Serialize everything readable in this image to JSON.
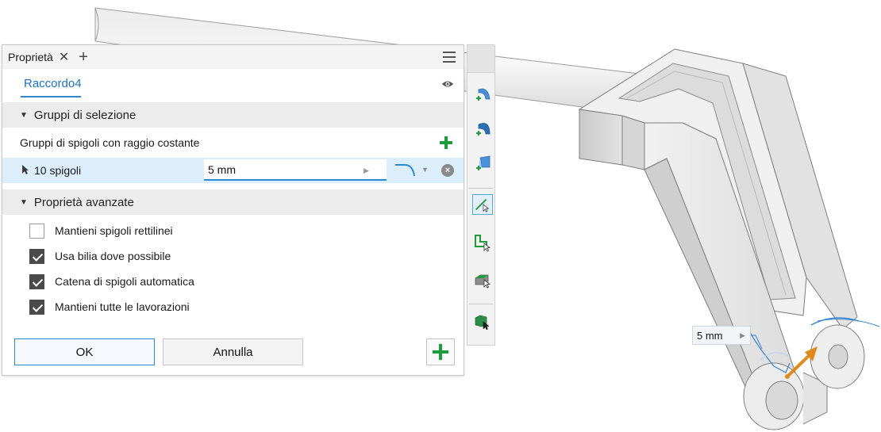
{
  "panel": {
    "tab_label": "Proprietà",
    "tab_close": "✕",
    "tab_add": "+",
    "feature_name": "Raccordo4",
    "sections": {
      "selection_groups": "Gruppi di selezione",
      "advanced": "Proprietà avanzate"
    },
    "constant_radius_label": "Gruppi di spigoli con raggio costante",
    "edge_row": {
      "edges": "10 spigoli",
      "radius_value": "5 mm"
    },
    "options": [
      {
        "label": "Mantieni spigoli rettilinei",
        "checked": false
      },
      {
        "label": "Usa bilia dove possibile",
        "checked": true
      },
      {
        "label": "Catena di spigoli automatica",
        "checked": true
      },
      {
        "label": "Mantieni tutte le lavorazioni",
        "checked": true
      }
    ],
    "buttons": {
      "ok": "OK",
      "cancel": "Annulla"
    }
  },
  "viewport": {
    "dimension_label": "5 mm"
  },
  "toolbar": {
    "icons": [
      "constant-fillet-icon",
      "variable-fillet-icon",
      "setback-fillet-icon",
      "select-edge-icon",
      "select-loop-icon",
      "select-feature-icon",
      "select-solid-icon"
    ]
  },
  "colors": {
    "accent": "#2a8ad4",
    "add_green": "#1e9b3b",
    "highlight_row": "#dceefb",
    "preview_orange": "#e08a1e"
  }
}
